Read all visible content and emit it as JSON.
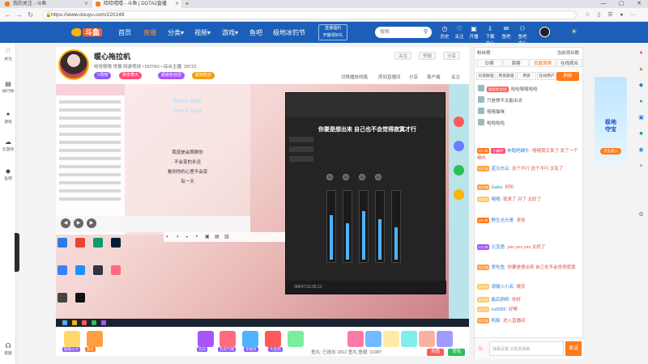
{
  "browser": {
    "tabs": [
      {
        "title": "我的关注 - 斗鱼"
      },
      {
        "title": "哈哈嘻嘻 - 斗鱼 | DOTA2直播"
      }
    ],
    "url": "https://www.douyu.com/220149",
    "window_controls": [
      "—",
      "▢",
      "✕"
    ]
  },
  "header": {
    "logo": "斗鱼",
    "nav": [
      "首页",
      "直播",
      "分类",
      "视频",
      "游戏",
      "鱼吧",
      "极地冰钓节"
    ],
    "active_nav": "直播",
    "promo_line1": "直播福利",
    "promo_line2": "开播领好礼",
    "search_placeholder": "搜索",
    "icons": [
      "历史",
      "关注",
      "开播",
      "下载中心",
      "鱼吧",
      "鱼吧中心"
    ]
  },
  "leftbar": [
    "关注",
    "排行榜",
    "游戏",
    "云游戏",
    "鱼吧",
    "客服"
  ],
  "room": {
    "title": "暖心拖拉机",
    "category": "哈哈",
    "meta": "举报    网游竞技 • DOTA2 • 综合主播",
    "sub": "哈哈嘻嘻",
    "fans": "28723",
    "tags": [
      "V周榜",
      "我本寒大",
      "超级粉丝团",
      "超级粉丝"
    ],
    "buttons": [
      "关注",
      "举报",
      "分享"
    ],
    "links": [
      "切换播放线路",
      "房间直播间",
      "分享",
      "客户端",
      "关注"
    ]
  },
  "video": {
    "lyrics": [
      "Don't stop",
      "Don't stop",
      "我就是会照顾你",
      "不会变的永远",
      "看到你的心里不会变",
      "有一天"
    ],
    "daw_caption": "你要是想出来 自己也不会觉得寂寞才行",
    "daw_time": "00047.02.06.12",
    "desk_icons": [
      "Edit",
      "Google Chrome",
      "Microsoft Edge",
      "Adobe Photoshop",
      "Wallpaper Engine",
      "QQ",
      "Snipaste",
      "CLIP",
      "Web",
      "OBS"
    ]
  },
  "gifts": {
    "items": [
      "荧光棒",
      "办卡",
      "鱼丸",
      "弱鸡",
      "6666",
      "飞机",
      "火箭"
    ],
    "labels": [
      "超级火力",
      "鱼丸",
      "告白",
      "告白气球",
      "幸福号",
      "大宝剑"
    ],
    "bottom_text": "鱼丸: 已送出 1812 鱼丸 鱼翅: 11987",
    "charge": "充值",
    "gift_btn": "背包"
  },
  "chat": {
    "top_left": "粉丝榜",
    "top_right": "当前观众数",
    "tabs": [
      "日榜",
      "周榜",
      "贡献周榜",
      "在线观众"
    ],
    "tabs2": [
      "日贡献值",
      "周贡献值",
      "贵族",
      "在线用户"
    ],
    "rank_btn": "刷新",
    "ranks": [
      {
        "badge": "超级粉丝团",
        "text": "哈哈嘻嘻哈哈"
      },
      {
        "badge": "",
        "text": "只是想不太能出去"
      },
      {
        "badge": "",
        "text": "嘻嘻猫咪"
      },
      {
        "badge": "",
        "text": "啦啦啦啦"
      }
    ],
    "messages": [
      {
        "lv": "LV 30",
        "badge": "小蜗牛",
        "user": "奔跑吧蜗牛:",
        "text": "嘻嘻我又来了 发了一个喇叭"
      },
      {
        "lv": "LV 26",
        "badge": "",
        "user": "蓝天白云:",
        "text": "这个不行 这个不行 太乱了"
      },
      {
        "lv": "LV 28",
        "badge": "",
        "user": "Gabu:",
        "text": "好听"
      },
      {
        "lv": "LV 22",
        "badge": "",
        "user": "嘻嘻:",
        "text": "我来了 对了 太好了"
      },
      {
        "lv": "LV 30",
        "badge": "",
        "user": "野生光头哥:",
        "text": "来啦"
      },
      {
        "lv": "LV 29",
        "badge": "",
        "user": "元宝君:",
        "text": "yes yes yes 太好了"
      },
      {
        "lv": "LV 25",
        "badge": "",
        "user": "爱吃鱼:",
        "text": "你要是想出来 自己也不会觉得寂寞"
      },
      {
        "lv": "LV 27",
        "badge": "",
        "user": "请输入小名:",
        "text": "晚安"
      },
      {
        "lv": "LV 24",
        "badge": "",
        "user": "最后剧终:",
        "text": "你好"
      },
      {
        "lv": "LV 21",
        "badge": "",
        "user": "cu6582:",
        "text": "好棒"
      },
      {
        "lv": "LV 23",
        "badge": "",
        "user": "鸭梨:",
        "text": "进入直播间"
      }
    ],
    "input_placeholder": "弹幕设置 点我发弹幕",
    "send": "发送"
  },
  "ad": {
    "title_1": "极地",
    "title_2": "夺宝",
    "btn": "点击进入"
  },
  "colors": {
    "brand_blue": "#1d5fb8",
    "accent_orange": "#ff7a18"
  }
}
